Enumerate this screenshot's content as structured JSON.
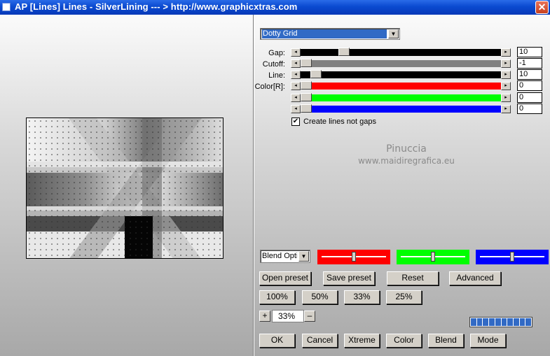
{
  "window": {
    "title": "AP [Lines]  Lines - SilverLining     --- > http://www.graphicxtras.com",
    "close_glyph": "✕"
  },
  "preset": {
    "selected": "Dotty Grid"
  },
  "sliders": [
    {
      "label": "Gap:",
      "value": "10",
      "track_color": "#000000",
      "position": 0.2
    },
    {
      "label": "Cutoff:",
      "value": "-1",
      "track_color": "#808080",
      "position": 0.0
    },
    {
      "label": "Line:",
      "value": "10",
      "track_color": "#000000",
      "position": 0.05
    },
    {
      "label": "Color[R]:",
      "value": "0",
      "track_color": "#ff0000",
      "position": 0.0
    },
    {
      "label": "",
      "value": "0",
      "track_color": "#00ff00",
      "position": 0.0
    },
    {
      "label": "",
      "value": "0",
      "track_color": "#0000ff",
      "position": 0.0
    }
  ],
  "checkbox": {
    "label": "Create lines not gaps",
    "checked": true,
    "mark": "✔"
  },
  "watermark": {
    "line1": "Pinuccia",
    "line2": "www.maidiregrafica.eu"
  },
  "blend": {
    "mode_selected": "Blend Option",
    "swatches": [
      {
        "color": "#ff0000",
        "level": 0.5
      },
      {
        "color": "#00ff00",
        "level": 0.5
      },
      {
        "color": "#0000ff",
        "level": 0.5
      }
    ]
  },
  "buttons": {
    "open_preset": "Open preset",
    "save_preset": "Save preset",
    "reset": "Reset",
    "advanced": "Advanced",
    "zoom100": "100%",
    "zoom50": "50%",
    "zoom33": "33%",
    "zoom25": "25%",
    "ok": "OK",
    "cancel": "Cancel",
    "xtreme": "Xtreme",
    "color": "Color",
    "blend": "Blend",
    "mode": "Mode"
  },
  "zoom": {
    "value": "33%",
    "plus": "+",
    "minus": "–"
  },
  "progress": {
    "segments": 10
  },
  "icons": {
    "dropdown": "chevron-down-icon",
    "arrow_left": "arrow-left-icon",
    "arrow_right": "arrow-right-icon",
    "checkbox": "check-icon"
  }
}
